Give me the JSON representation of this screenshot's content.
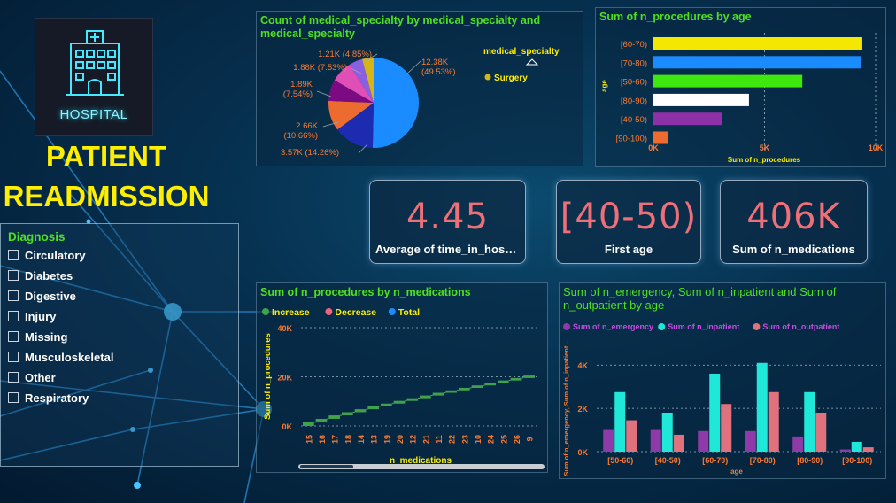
{
  "logo": {
    "text": "HOSPITAL",
    "icon": "hospital-building-icon"
  },
  "main_title": {
    "line1": "PATIENT",
    "line2": "READMISSION"
  },
  "slicer": {
    "title": "Diagnosis",
    "items": [
      "Circulatory",
      "Diabetes",
      "Digestive",
      "Injury",
      "Missing",
      "Musculoskeletal",
      "Other",
      "Respiratory"
    ]
  },
  "kpis": [
    {
      "value": "4.45",
      "label": "Average of time_in_hosp..."
    },
    {
      "value": "[40-50)",
      "label": "First age"
    },
    {
      "value": "406K",
      "label": "Sum of n_medications"
    }
  ],
  "colors": {
    "title_green": "#4fe01f",
    "title_yellow": "#ffee00",
    "kpi_value": "#ef6f78",
    "axis_orange": "#ff7a2f"
  },
  "chart_data": [
    {
      "type": "pie",
      "title": "Count of medical_specialty by medical_specialty and medical_specialty",
      "legend_title": "medical_specialty",
      "legend_visible_item": "Surgery",
      "legend_visible_color": "#d6b516",
      "slices": [
        {
          "value": 12380,
          "label": "12.38K",
          "pct": "(49.53%)",
          "color": "#1a8cff"
        },
        {
          "value": 3570,
          "label": "3.57K (14.26%)",
          "color": "#1d2bb0"
        },
        {
          "value": 2660,
          "label": "2.66K",
          "pct": "(10.66%)",
          "color": "#ee6b2f"
        },
        {
          "value": 1890,
          "label": "1.89K",
          "pct": "(7.54%)",
          "color": "#7b0a83"
        },
        {
          "value": 1880,
          "label": "1.88K (7.53%)",
          "color": "#e04eb7"
        },
        {
          "value": 1210,
          "label": "1.21K (4.85%)",
          "color": "#8a5fe0"
        },
        {
          "value": 1010,
          "label": "",
          "color": "#d6b516"
        }
      ]
    },
    {
      "type": "bar",
      "orientation": "horizontal",
      "title": "Sum of n_procedures by age",
      "xlabel": "Sum of n_procedures",
      "ylabel": "age",
      "categories": [
        "[60-70)",
        "[70-80)",
        "[50-60)",
        "[80-90)",
        "[40-50)",
        "[90-100)"
      ],
      "values": [
        9400,
        9350,
        6700,
        4300,
        3100,
        650
      ],
      "bar_colors": [
        "#f5e800",
        "#1a8cff",
        "#3ee80f",
        "#ffffff",
        "#8e30a8",
        "#ee6b2f"
      ],
      "xlim": [
        0,
        10000
      ],
      "xticks": [
        "0K",
        "5K",
        "10K"
      ]
    },
    {
      "type": "bar",
      "subtype": "waterfall",
      "title": "Sum of n_procedures by n_medications",
      "xlabel": "n_medications",
      "ylabel": "Sum of n_procedures",
      "legend": [
        {
          "name": "Increase",
          "color": "#3fa34d"
        },
        {
          "name": "Decrease",
          "color": "#f0617a"
        },
        {
          "name": "Total",
          "color": "#1a8cff"
        }
      ],
      "categories": [
        "15",
        "16",
        "17",
        "18",
        "14",
        "13",
        "19",
        "20",
        "12",
        "21",
        "11",
        "22",
        "23",
        "10",
        "24",
        "25",
        "26",
        "9"
      ],
      "cumulative": [
        1500,
        2900,
        4300,
        5600,
        6800,
        8000,
        9100,
        10200,
        11300,
        12400,
        13500,
        14500,
        15500,
        16500,
        17500,
        18500,
        19500,
        20500
      ],
      "ylim": [
        0,
        40000
      ],
      "yticks": [
        "0K",
        "20K",
        "40K"
      ]
    },
    {
      "type": "bar",
      "subtype": "grouped",
      "title": "Sum of n_emergency, Sum of n_inpatient and Sum of n_outpatient by age",
      "xlabel": "age",
      "ylabel": "Sum of n_emergency, Sum of n_inpatient ...",
      "categories": [
        "[50-60)",
        "[40-50)",
        "[60-70)",
        "[70-80)",
        "[80-90)",
        "[90-100)"
      ],
      "series": [
        {
          "name": "Sum of n_emergency",
          "color": "#8e3aa8",
          "values": [
            1000,
            1000,
            950,
            950,
            700,
            100
          ]
        },
        {
          "name": "Sum of n_inpatient",
          "color": "#20e8d8",
          "values": [
            2750,
            1800,
            3600,
            4100,
            2750,
            450
          ]
        },
        {
          "name": "Sum of n_outpatient",
          "color": "#e0727d",
          "values": [
            1450,
            780,
            2200,
            2750,
            1800,
            200
          ]
        }
      ],
      "ylim": [
        0,
        4500
      ],
      "yticks": [
        "0K",
        "2K",
        "4K"
      ]
    }
  ]
}
